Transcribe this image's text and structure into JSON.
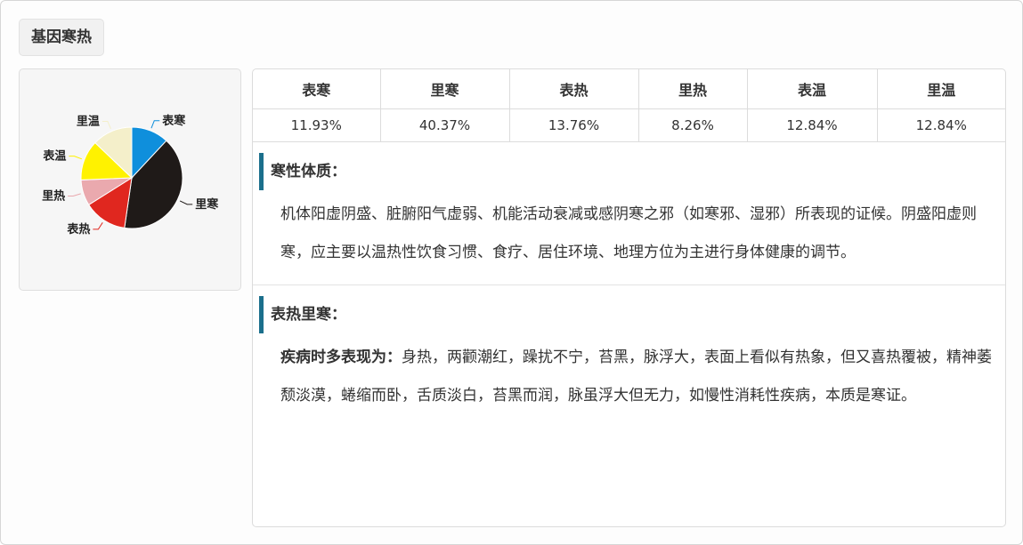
{
  "page": {
    "title": "基因寒热"
  },
  "chart_data": {
    "type": "pie",
    "categories": [
      "表寒",
      "里寒",
      "表热",
      "里热",
      "表温",
      "里温"
    ],
    "values": [
      11.93,
      40.37,
      13.76,
      8.26,
      12.84,
      12.84
    ],
    "colors": [
      "#0f8fdc",
      "#1f1a18",
      "#e0271f",
      "#eaa9ae",
      "#fff200",
      "#f4efca"
    ],
    "start": "12 o'clock, clockwise",
    "legend": "none (labels beside slices)"
  },
  "table": {
    "headers": [
      "表寒",
      "里寒",
      "表热",
      "里热",
      "表温",
      "里温"
    ],
    "values": [
      "11.93%",
      "40.37%",
      "13.76%",
      "8.26%",
      "12.84%",
      "12.84%"
    ]
  },
  "sections": [
    {
      "title": "寒性体质：",
      "lead": "",
      "text": "机体阳虚阴盛、脏腑阳气虚弱、机能活动衰减或感阴寒之邪（如寒邪、湿邪）所表现的证候。阴盛阳虚则寒，应主要以温热性饮食习惯、食疗、居住环境、地理方位为主进行身体健康的调节。"
    },
    {
      "title": "表热里寒：",
      "lead": "疾病时多表现为：",
      "text": "身热，两颧潮红，躁扰不宁，苔黑，脉浮大，表面上看似有热象，但又喜热覆被，精神萎颓淡漠，蜷缩而卧，舌质淡白，苔黑而润，脉虽浮大但无力，如慢性消耗性疾病，本质是寒证。"
    }
  ],
  "accent_color": "#1b6f8c"
}
